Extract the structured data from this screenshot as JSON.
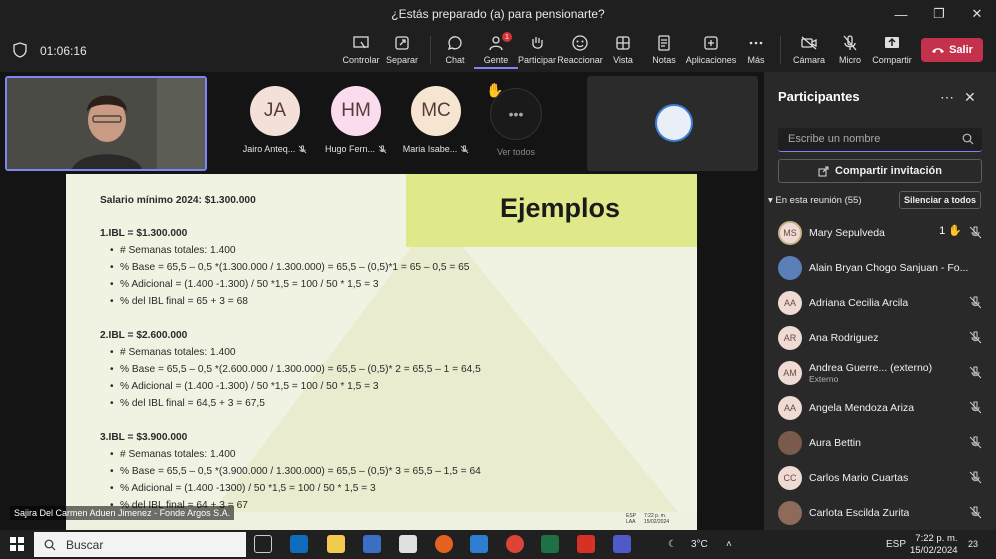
{
  "window": {
    "title": "¿Estás preparado (a) para pensionarte?"
  },
  "meeting": {
    "timer": "01:06:16"
  },
  "toolbar": {
    "controlar": "Controlar",
    "separar": "Separar",
    "chat": "Chat",
    "gente": "Gente",
    "gente_badge": "1",
    "participar": "Participar",
    "reaccionar": "Reaccionar",
    "vista": "Vista",
    "notas": "Notas",
    "aplicaciones": "Aplicaciones",
    "mas": "Más",
    "camara": "Cámara",
    "micro": "Micro",
    "compartir": "Compartir",
    "salir": "Salir"
  },
  "gallery": {
    "tiles": [
      {
        "initials": "JA",
        "name": "Jairo Anteq...",
        "color": "#f3e0d9"
      },
      {
        "initials": "HM",
        "name": "Hugo Fern...",
        "color": "#fbdcef"
      },
      {
        "initials": "MC",
        "name": "Maria Isabe...",
        "color": "#f6e5d0"
      }
    ],
    "more_label": "Ver todos",
    "presenter_name": "Sajira Del Carmen Aduen Jimenez - Fonde Argos S.A."
  },
  "slide": {
    "title": "Ejemplos",
    "lines": [
      {
        "text": "Salario mínimo 2024: $1.300.000",
        "bold": true,
        "indent": 0
      },
      {
        "text": "1.IBL = $1.300.000",
        "bold": true,
        "indent": 0
      },
      {
        "text": "# Semanas totales: 1.400",
        "bold": false,
        "indent": 1
      },
      {
        "text": "% Base = 65,5 – 0,5 *(1.300.000 / 1.300.000) = 65,5 – (0,5)*1 = 65 – 0,5 = 65",
        "bold": false,
        "indent": 1
      },
      {
        "text": "% Adicional = (1.400 -1.300) / 50 *1,5 = 100 / 50 * 1,5 = 3",
        "bold": false,
        "indent": 1
      },
      {
        "text": "% del IBL final = 65 + 3 = 68",
        "bold": false,
        "indent": 1
      },
      {
        "text": "2.IBL = $2.600.000",
        "bold": true,
        "indent": 0
      },
      {
        "text": "# Semanas totales: 1.400",
        "bold": false,
        "indent": 1
      },
      {
        "text": "% Base = 65,5 – 0,5 *(2.600.000 / 1.300.000) = 65,5 – (0,5)* 2 = 65,5 – 1 = 64,5",
        "bold": false,
        "indent": 1
      },
      {
        "text": "% Adicional = (1.400 -1.300) / 50 *1,5 = 100 / 50 * 1,5 = 3",
        "bold": false,
        "indent": 1
      },
      {
        "text": "% del IBL final = 64,5 + 3 = 67,5",
        "bold": false,
        "indent": 1
      },
      {
        "text": "3.IBL = $3.900.000",
        "bold": true,
        "indent": 0
      },
      {
        "text": "# Semanas totales: 1.400",
        "bold": false,
        "indent": 1
      },
      {
        "text": "% Base = 65,5 – 0,5 *(3.900.000 / 1.300.000) = 65,5 – (0,5)* 3 = 65,5 – 1,5 = 64",
        "bold": false,
        "indent": 1
      },
      {
        "text": "% Adicional = (1.400 -1300) / 50 *1,5 = 100 / 50 * 1,5 = 3",
        "bold": false,
        "indent": 1
      },
      {
        "text": "% del IBL final = 64 + 3 = 67",
        "bold": false,
        "indent": 1
      }
    ],
    "mini_lang": "ESP\nLAA",
    "mini_time": "7:22 p. m.\n15/02/2024"
  },
  "panel": {
    "title": "Participantes",
    "search_placeholder": "Escribe un nombre",
    "invite": "Compartir invitación",
    "section": "En esta reunión (55)",
    "mute_all": "Silenciar a todos",
    "participants": [
      {
        "initials": "MS",
        "name": "Mary Sepulveda",
        "sub": "",
        "hand": "1",
        "photo": false,
        "ring": true
      },
      {
        "initials": "",
        "name": "Alain Bryan Chogo Sanjuan - Fo...",
        "sub": "",
        "hand": "",
        "photo": true,
        "ring": false
      },
      {
        "initials": "AA",
        "name": "Adriana Cecilia Arcila",
        "sub": "",
        "hand": "",
        "photo": false,
        "ring": false
      },
      {
        "initials": "AR",
        "name": "Ana Rodriguez",
        "sub": "",
        "hand": "",
        "photo": false,
        "ring": false
      },
      {
        "initials": "AM",
        "name": "Andrea Guerre...  (externo)",
        "sub": "Externo",
        "hand": "",
        "photo": false,
        "ring": false
      },
      {
        "initials": "AA",
        "name": "Angela Mendoza Ariza",
        "sub": "",
        "hand": "",
        "photo": false,
        "ring": false
      },
      {
        "initials": "",
        "name": "Aura Bettin",
        "sub": "",
        "hand": "",
        "photo": true,
        "ring": false
      },
      {
        "initials": "CC",
        "name": "Carlos Mario Cuartas",
        "sub": "",
        "hand": "",
        "photo": false,
        "ring": false
      },
      {
        "initials": "",
        "name": "Carlota Escilda Zurita",
        "sub": "",
        "hand": "",
        "photo": true,
        "ring": false
      }
    ]
  },
  "taskbar": {
    "search": "Buscar",
    "weather": "3°C",
    "lang": "ESP",
    "time": "7:22 p. m.",
    "date": "15/02/2024",
    "notifications": "23"
  },
  "colors": {
    "accent": "#7f85f5",
    "leave": "#c4314b",
    "slide_band": "#dfe98a"
  }
}
